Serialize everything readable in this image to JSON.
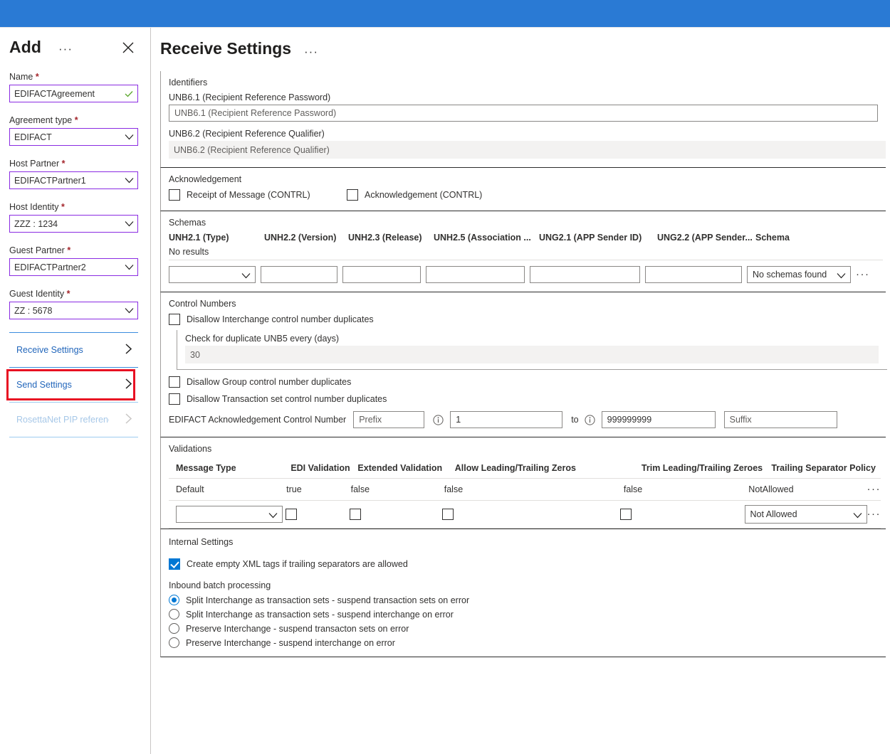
{
  "topbar": {
    "color": "#2a7ad4"
  },
  "blade": {
    "title": "Add",
    "ellipsis": "···",
    "close_icon": "close-icon",
    "fields": [
      {
        "label": "Name",
        "required": true,
        "value": "EDIFACTAgreement",
        "adorn": "check-icon"
      },
      {
        "label": "Agreement type",
        "required": true,
        "value": "EDIFACT",
        "adorn": "chevron-down-icon"
      },
      {
        "label": "Host Partner",
        "required": true,
        "value": "EDIFACTPartner1",
        "adorn": "chevron-down-icon"
      },
      {
        "label": "Host Identity",
        "required": true,
        "value": "ZZZ : 1234",
        "adorn": "chevron-down-icon"
      },
      {
        "label": "Guest Partner",
        "required": true,
        "value": "EDIFACTPartner2",
        "adorn": "chevron-down-icon"
      },
      {
        "label": "Guest Identity",
        "required": true,
        "value": "ZZ : 5678",
        "adorn": "chevron-down-icon"
      }
    ],
    "nav": [
      {
        "label": "Receive Settings",
        "selected": true,
        "disabled": false
      },
      {
        "label": "Send Settings",
        "selected": false,
        "disabled": false
      },
      {
        "label": "RosettaNet PIP referenc",
        "selected": false,
        "disabled": true
      }
    ],
    "highlight_color": "#e81123"
  },
  "content": {
    "title": "Receive Settings",
    "ellipsis": "···",
    "identifiers": {
      "title": "Identifiers",
      "unb61_label": "UNB6.1 (Recipient Reference Password)",
      "unb61_placeholder": "UNB6.1 (Recipient Reference Password)",
      "unb62_label": "UNB6.2 (Recipient Reference Qualifier)",
      "unb62_placeholder": "UNB6.2 (Recipient Reference Qualifier)"
    },
    "acknowledgement": {
      "title": "Acknowledgement",
      "receipt_label": "Receipt of Message (CONTRL)",
      "receipt_checked": false,
      "ack_label": "Acknowledgement (CONTRL)",
      "ack_checked": false
    },
    "schemas": {
      "title": "Schemas",
      "columns": [
        "UNH2.1 (Type)",
        "UNH2.2 (Version)",
        "UNH2.3 (Release)",
        "UNH2.5 (Association ...",
        "UNG2.1 (APP Sender ID)",
        "UNG2.2 (APP Sender...",
        "Schema"
      ],
      "no_results": "No results",
      "schema_select_value": "No schemas found",
      "row_menu": "···"
    },
    "control_numbers": {
      "title": "Control Numbers",
      "disallow_interchange_label": "Disallow Interchange control number duplicates",
      "disallow_interchange_checked": false,
      "check_duplicate_label": "Check for duplicate UNB5 every (days)",
      "check_duplicate_value": "30",
      "disallow_group_label": "Disallow Group control number duplicates",
      "disallow_group_checked": false,
      "disallow_txset_label": "Disallow Transaction set control number duplicates",
      "disallow_txset_checked": false,
      "ack_control_label": "EDIFACT Acknowledgement Control Number",
      "prefix_placeholder": "Prefix",
      "from_value": "1",
      "to_label": "to",
      "to_value": "999999999",
      "suffix_placeholder": "Suffix"
    },
    "validations": {
      "title": "Validations",
      "columns": [
        "Message Type",
        "EDI Validation",
        "Extended Validation",
        "Allow Leading/Trailing Zeros",
        "Trim Leading/Trailing Zeroes",
        "Trailing Separator Policy"
      ],
      "rows": [
        {
          "message_type": "Default",
          "edi_validation": "true",
          "extended_validation": "false",
          "allow_zeros": "false",
          "trim_zeros": "false",
          "trailing_separator_policy": "NotAllowed",
          "menu": "···"
        }
      ],
      "edit_row": {
        "message_type_value": "",
        "edi_validation_checked": false,
        "extended_validation_checked": false,
        "allow_zeros_checked": false,
        "trim_zeros_checked": false,
        "trailing_separator_policy_value": "Not Allowed",
        "menu": "···"
      }
    },
    "internal_settings": {
      "title": "Internal Settings",
      "create_empty_xml_label": "Create empty XML tags if trailing separators are allowed",
      "create_empty_xml_checked": true,
      "inbound_batch_label": "Inbound batch processing",
      "options": [
        {
          "label": "Split Interchange as transaction sets - suspend transaction sets on error",
          "selected": true
        },
        {
          "label": "Split Interchange as transaction sets - suspend interchange on error",
          "selected": false
        },
        {
          "label": "Preserve Interchange - suspend transacton sets on error",
          "selected": false
        },
        {
          "label": "Preserve Interchange - suspend interchange on error",
          "selected": false
        }
      ]
    }
  }
}
